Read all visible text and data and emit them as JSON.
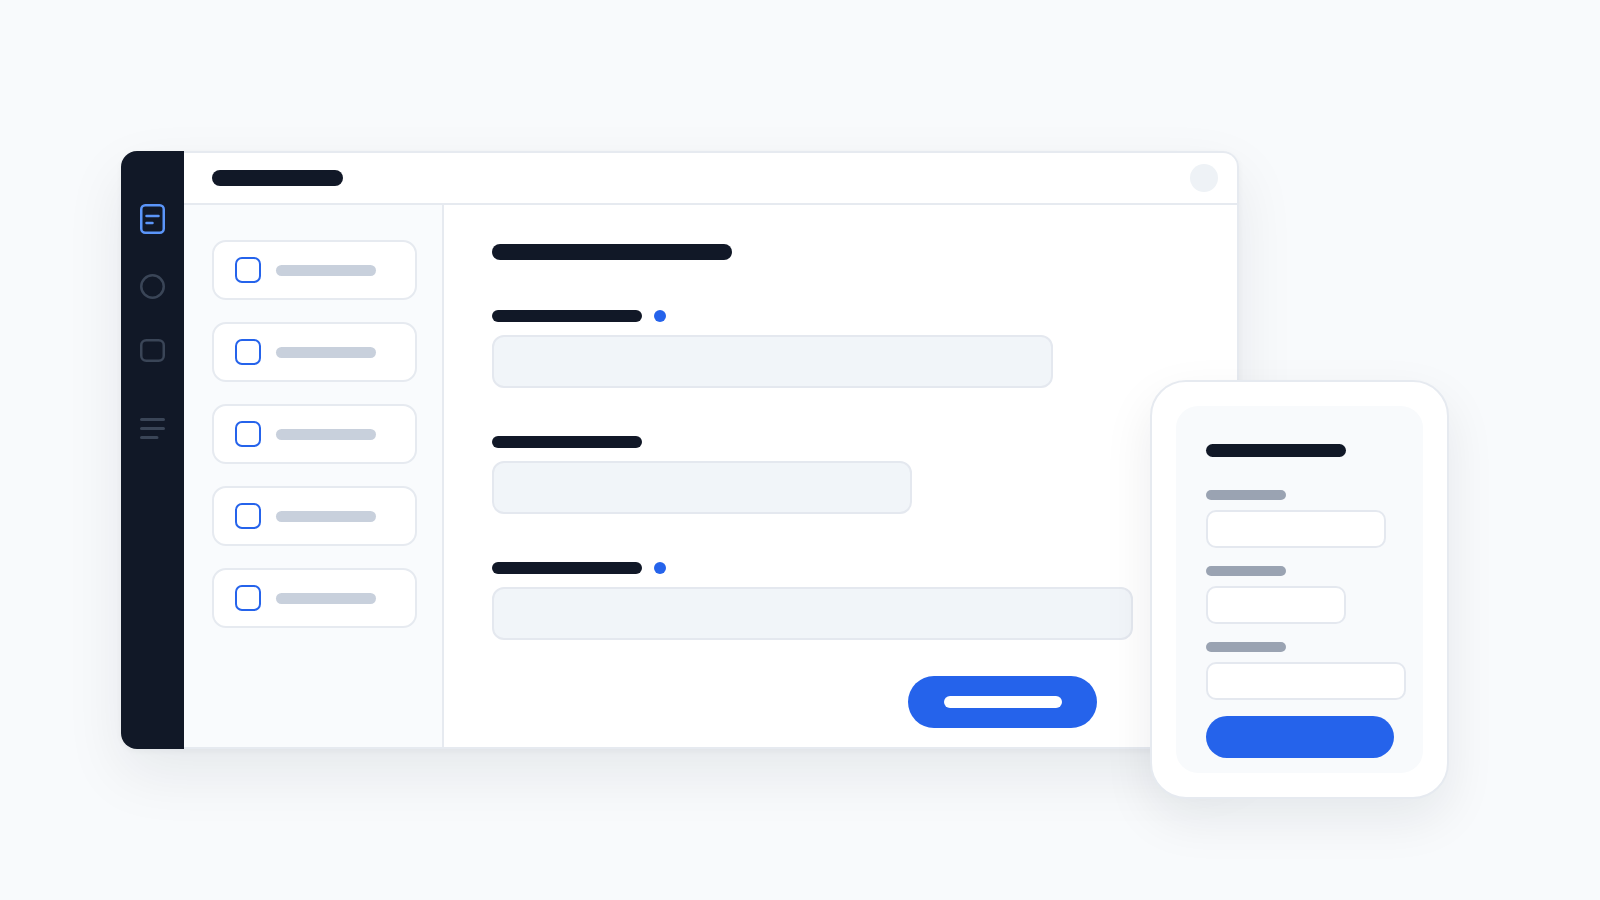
{
  "sidebar": {
    "nav": [
      {
        "kind": "document",
        "selected": true
      },
      {
        "kind": "circle",
        "selected": false
      },
      {
        "kind": "square",
        "selected": false
      },
      {
        "kind": "lines",
        "selected": false
      }
    ]
  },
  "list": {
    "items": [
      {
        "checked": false
      },
      {
        "checked": false
      },
      {
        "checked": false
      },
      {
        "checked": false
      },
      {
        "checked": false
      }
    ]
  },
  "form": {
    "fields": [
      {
        "required": true
      },
      {
        "required": false
      },
      {
        "required": true
      }
    ]
  },
  "mobile_form": {
    "fields": [
      {
        "required": false
      },
      {
        "required": false
      },
      {
        "required": false
      }
    ]
  }
}
